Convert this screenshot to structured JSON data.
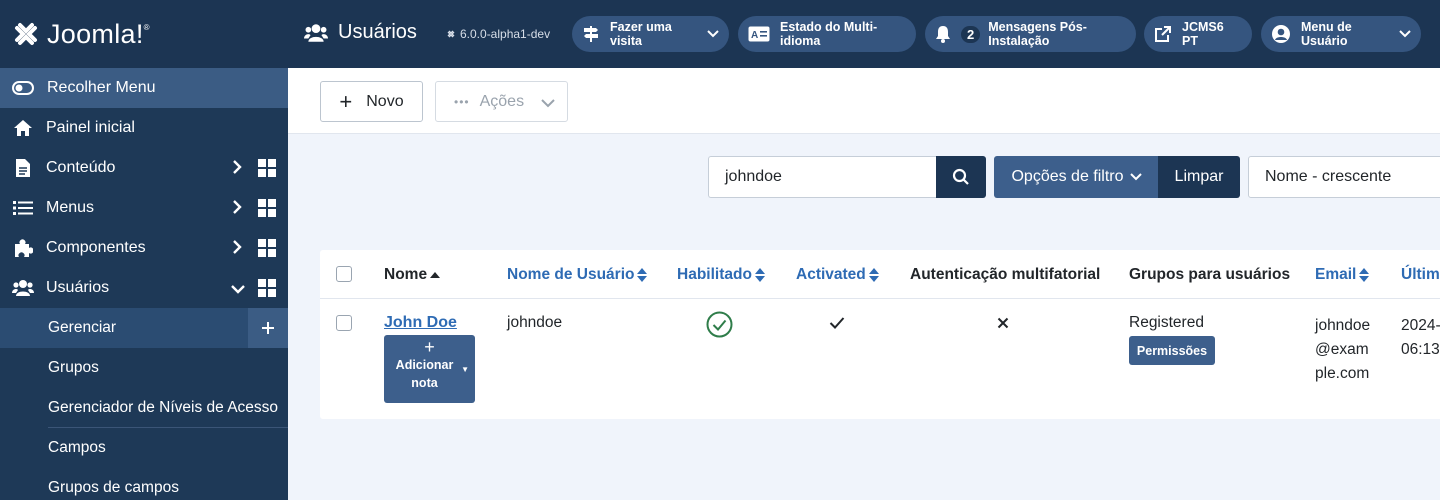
{
  "brand": {
    "name": "Joomla!",
    "mark": "®"
  },
  "sidebar": {
    "collapse_label": "Recolher Menu",
    "items": [
      {
        "label": "Painel inicial",
        "icon": "home-icon"
      },
      {
        "label": "Conteúdo",
        "icon": "file-icon"
      },
      {
        "label": "Menus",
        "icon": "list-icon"
      },
      {
        "label": "Componentes",
        "icon": "puzzle-icon"
      },
      {
        "label": "Usuários",
        "icon": "users-icon"
      }
    ],
    "sub_items": [
      {
        "label": "Gerenciar"
      },
      {
        "label": "Grupos"
      },
      {
        "label": "Gerenciador de Níveis de Acesso"
      },
      {
        "label": "Campos"
      },
      {
        "label": "Grupos de campos"
      }
    ]
  },
  "header": {
    "title": "Usuários",
    "version": "6.0.0-alpha1-dev",
    "pills": [
      {
        "label": "Fazer uma visita",
        "icon": "signpost-icon"
      },
      {
        "label": "Estado do Multi-idioma",
        "icon": "language-icon"
      },
      {
        "label": "Mensagens Pós-Instalação",
        "icon": "bell-icon",
        "count": "2"
      },
      {
        "label": "JCMS6 PT",
        "icon": "external-link-icon"
      },
      {
        "label": "Menu de Usuário",
        "icon": "user-circle-icon"
      }
    ]
  },
  "toolbar": {
    "new_label": "Novo",
    "actions_label": "Ações"
  },
  "filter": {
    "search_value": "johndoe",
    "filter_options_label": "Opções de filtro",
    "clear_label": "Limpar",
    "sort_value": "Nome - crescente"
  },
  "table": {
    "columns": {
      "name": "Nome",
      "username": "Nome de Usuário",
      "enabled": "Habilitado",
      "activated": "Activated",
      "mfa": "Autenticação multifatorial",
      "groups": "Grupos para usuários",
      "email": "Email",
      "last_visit": "Últim"
    },
    "rows": [
      {
        "name": "John Doe",
        "add_note_label": "Adicionar nota",
        "username": "johndoe",
        "group": "Registered",
        "permissions_label": "Permissões",
        "email": "johndoe@example.com",
        "last_visit_date": "2024-",
        "last_visit_time": "06:13"
      }
    ]
  },
  "colors": {
    "sidebar": "#1e3957",
    "header": "#1c3553",
    "accent": "#3d5f8c",
    "link": "#2e6bb4",
    "success": "#2f7d4a"
  }
}
